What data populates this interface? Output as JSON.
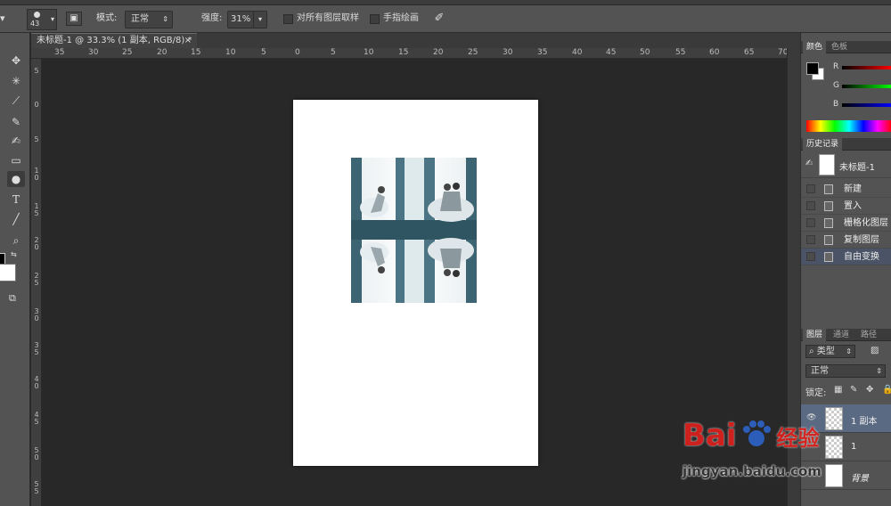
{
  "options_bar": {
    "brush_size": "43",
    "mode_label": "模式:",
    "mode_value": "正常",
    "strength_label": "强度:",
    "strength_value": "31%",
    "sample_all_layers_label": "对所有图层取样",
    "finger_painting_label": "手指绘画"
  },
  "document_tab": {
    "title": "未标题-1 @ 33.3% (1 副本, RGB/8) *",
    "close": "×"
  },
  "ruler_top": [
    "35",
    "30",
    "25",
    "20",
    "15",
    "10",
    "5",
    "0",
    "5",
    "10",
    "15",
    "20",
    "25",
    "30",
    "35",
    "40",
    "45",
    "50",
    "55",
    "60",
    "65",
    "70"
  ],
  "ruler_left": [
    "5",
    "0",
    "5",
    "1\n0",
    "1\n5",
    "2\n0",
    "2\n5",
    "3\n0",
    "3\n5",
    "4\n0",
    "4\n5",
    "5\n0",
    "5\n5"
  ],
  "color_panel": {
    "tabs": [
      "颜色",
      "色板"
    ],
    "channels": [
      "R",
      "G",
      "B"
    ]
  },
  "history_panel": {
    "tab": "历史记录",
    "snapshot": "未标题-1",
    "items": [
      "新建",
      "置入",
      "栅格化图层",
      "复制图层",
      "自由变换"
    ],
    "selected_index": 4
  },
  "layers_panel": {
    "tabs": [
      "图层",
      "通道",
      "路径"
    ],
    "filter_kind": "类型",
    "blend_mode": "正常",
    "lock_label": "锁定:",
    "layers": [
      {
        "name": "1 副本",
        "selected": true,
        "visible": true
      },
      {
        "name": "1",
        "selected": false,
        "visible": false
      },
      {
        "name": "背景",
        "selected": false,
        "visible": false
      }
    ]
  },
  "watermark": {
    "brand_latin": "Bai",
    "brand_suffix": "经验",
    "url": "jingyan.baidu.com"
  },
  "colors": {
    "accent_selected": "#5a6a82",
    "history_selected": "#4a5466",
    "watermark_red": "#e0211c"
  }
}
